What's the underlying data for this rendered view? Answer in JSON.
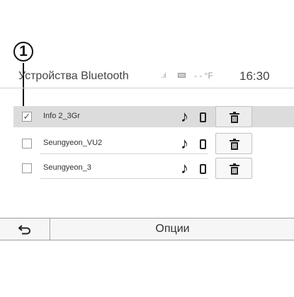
{
  "callout": {
    "number": "1"
  },
  "header": {
    "title": "Устройства Bluetooth",
    "signal": "..ıl",
    "temperature": "- - °F",
    "time": "16:30"
  },
  "devices": [
    {
      "name": "Info 2_3Gr",
      "checked": true
    },
    {
      "name": "Seungyeon_VU2",
      "checked": false
    },
    {
      "name": "Seungyeon_3",
      "checked": false
    }
  ],
  "icons": {
    "music": "music-note-icon",
    "phone": "phone-icon",
    "delete": "trash-icon",
    "back": "back-arrow-icon"
  },
  "glyphs": {
    "check": "✓",
    "music": "♪"
  },
  "bottom_bar": {
    "options_label": "Опции"
  }
}
